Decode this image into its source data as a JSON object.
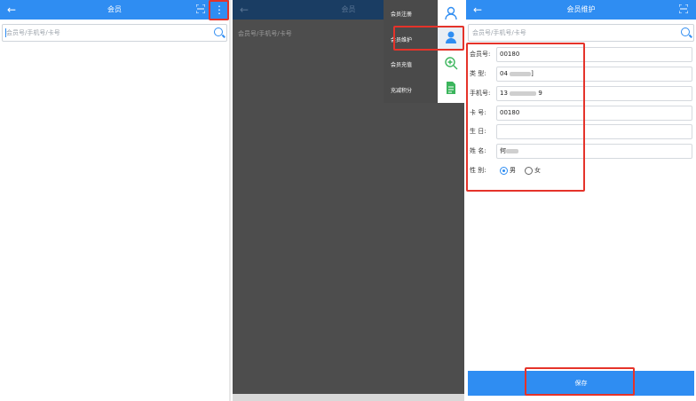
{
  "screen1": {
    "back": "←",
    "title": "会员",
    "search_placeholder": "会员号/手机号/卡号",
    "more_glyph": "⋮"
  },
  "screen2": {
    "back": "←",
    "title": "会员",
    "search_placeholder": "会员号/手机号/卡号",
    "menu": {
      "items": [
        "会员注册",
        "会员维护",
        "会员充值",
        "充减积分"
      ]
    }
  },
  "screen3": {
    "back": "←",
    "title": "会员维护",
    "search_placeholder": "会员号/手机号/卡号",
    "form": {
      "member_no_label": "会员号:",
      "member_no": "00180",
      "type_label": "类  型:",
      "type_prefix": "04",
      "type_suffix": "]",
      "phone_label": "手机号:",
      "phone_prefix": "13",
      "phone_suffix": "9",
      "card_label": "卡  号:",
      "card_no": "00180",
      "birthday_label": "生  日:",
      "birthday": "",
      "name_label": "姓  名:",
      "name_prefix": "何",
      "gender_label": "性  别:",
      "gender_male": "男",
      "gender_female": "女",
      "gender_selected": "男"
    },
    "save_label": "保存"
  },
  "colors": {
    "primary": "#2f8df2",
    "highlight": "#e5332a",
    "overlay": "#4d4d4d"
  }
}
